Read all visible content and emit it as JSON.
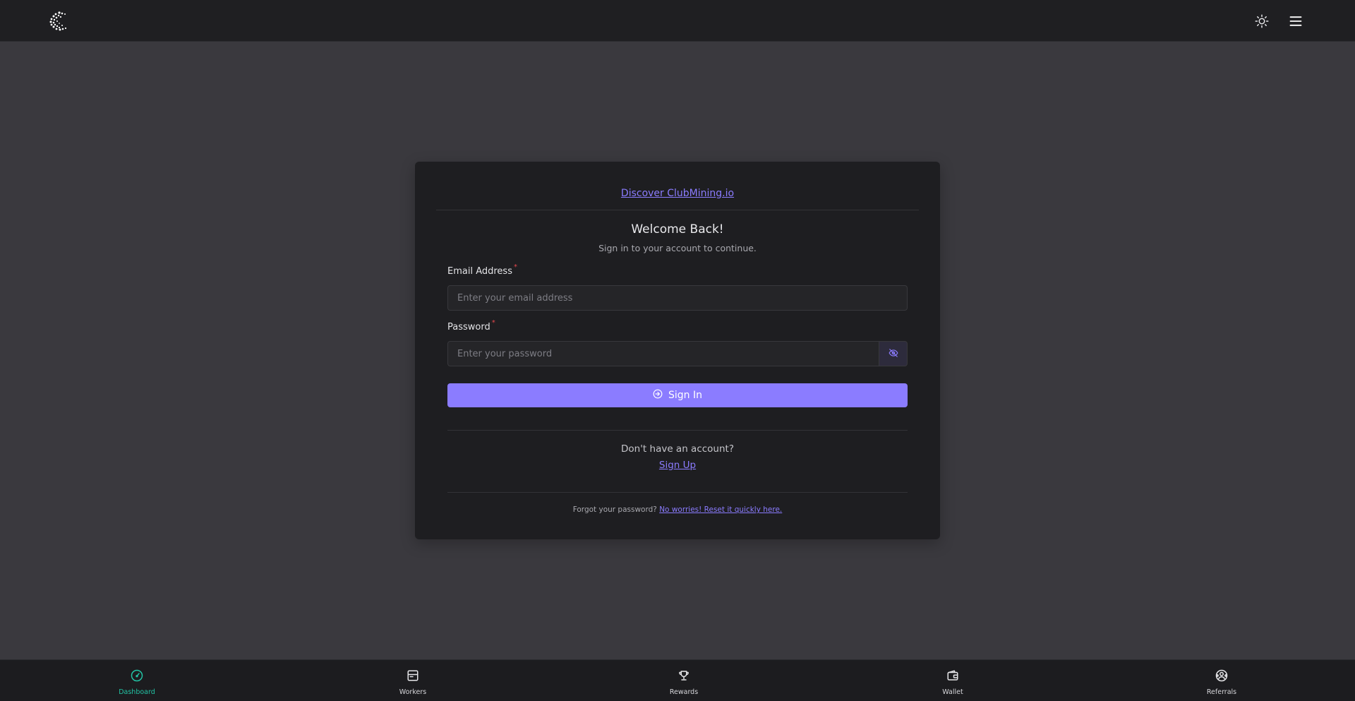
{
  "header": {
    "logo_icon": "clubmining-logo-icon",
    "theme_icon": "sun-icon",
    "menu_icon": "hamburger-menu-icon"
  },
  "card": {
    "discover_link": "Discover ClubMining.io",
    "title": "Welcome Back!",
    "subtitle": "Sign in to your account to continue.",
    "email": {
      "label": "Email Address",
      "required_mark": "*",
      "placeholder": "Enter your email address",
      "value": ""
    },
    "password": {
      "label": "Password",
      "required_mark": "*",
      "placeholder": "Enter your password",
      "value": "",
      "toggle_icon": "eye-off-icon"
    },
    "signin_button": "Sign In",
    "no_account_text": "Don't have an account?",
    "signup_link": "Sign Up",
    "forgot_text": "Forgot your password?",
    "reset_link": "No worries! Reset it quickly here."
  },
  "bottom_nav": {
    "items": [
      {
        "label": "Dashboard",
        "icon": "gauge-icon",
        "active": true
      },
      {
        "label": "Workers",
        "icon": "server-icon",
        "active": false
      },
      {
        "label": "Rewards",
        "icon": "trophy-icon",
        "active": false
      },
      {
        "label": "Wallet",
        "icon": "wallet-icon",
        "active": false
      },
      {
        "label": "Referrals",
        "icon": "referral-users-icon",
        "active": false
      }
    ]
  },
  "colors": {
    "accent": "#8b7cff",
    "active_nav": "#22c3a4",
    "required": "#e5484d",
    "background": "#3a393e",
    "surface": "#1e1e21"
  }
}
